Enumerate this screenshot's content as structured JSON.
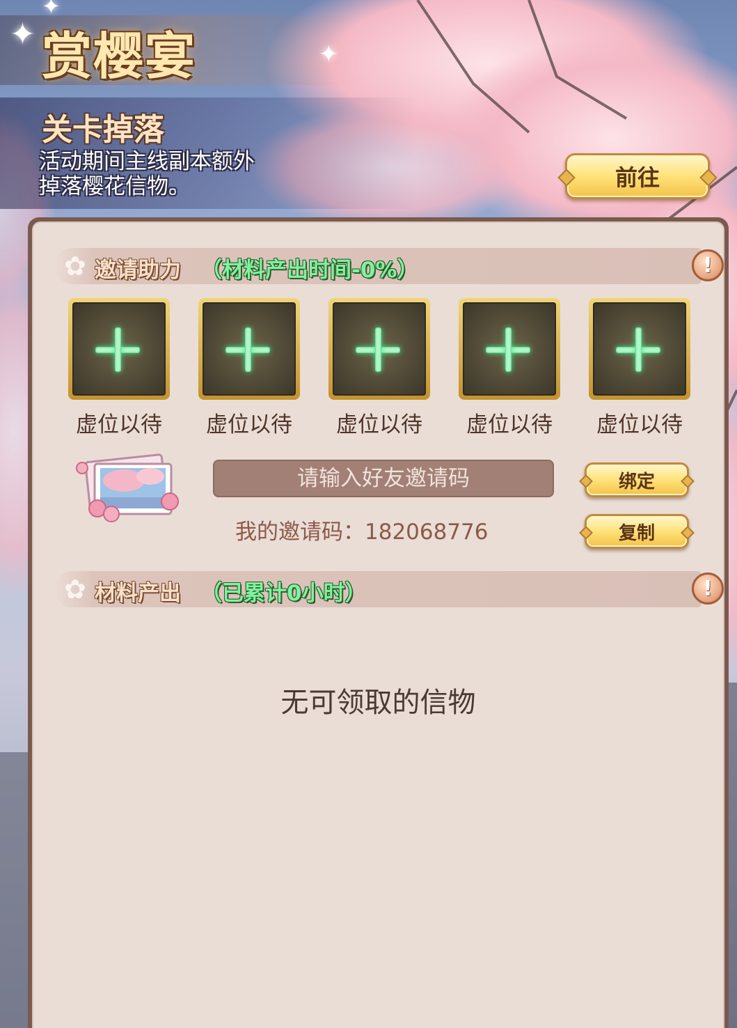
{
  "event": {
    "title": "赏樱宴",
    "subtitle": "关卡掉落",
    "description": "活动期间主线副本额外掉落樱花信物。",
    "goto_label": "前往"
  },
  "invite": {
    "section_label": "邀请助力",
    "section_note": "（材料产出时间-0%）",
    "info_icon": "!",
    "slots": [
      {
        "label": "虚位以待"
      },
      {
        "label": "虚位以待"
      },
      {
        "label": "虚位以待"
      },
      {
        "label": "虚位以待"
      },
      {
        "label": "虚位以待"
      }
    ],
    "input_placeholder": "请输入好友邀请码",
    "bind_label": "绑定",
    "copy_label": "复制",
    "my_code_label": "我的邀请码：182068776"
  },
  "output": {
    "section_label": "材料产出",
    "section_note": "（已累计0小时）",
    "info_icon": "!",
    "empty_text": "无可领取的信物"
  },
  "colors": {
    "accent_green": "#7ff2a0",
    "panel_bg": "#eaddd6",
    "button_gold": "#ffe27a"
  }
}
